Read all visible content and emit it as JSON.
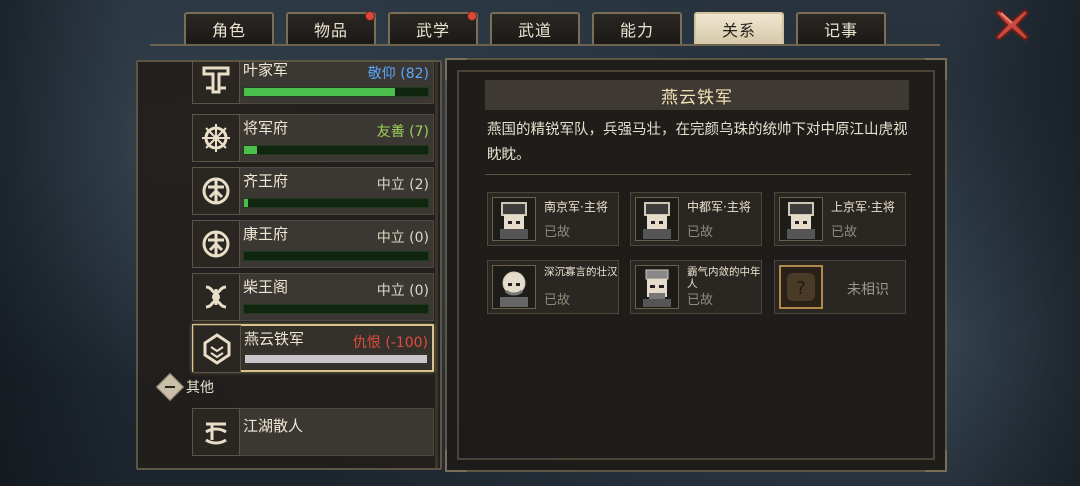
{
  "tabs": [
    {
      "label": "角色",
      "badge": false,
      "active": false
    },
    {
      "label": "物品",
      "badge": true,
      "active": false
    },
    {
      "label": "武学",
      "badge": true,
      "active": false
    },
    {
      "label": "武道",
      "badge": false,
      "active": false
    },
    {
      "label": "能力",
      "badge": false,
      "active": false
    },
    {
      "label": "关系",
      "badge": false,
      "active": true
    },
    {
      "label": "记事",
      "badge": false,
      "active": false
    }
  ],
  "factions": [
    {
      "name": "叶家军",
      "status": "敬仰 (82)",
      "status_color": "#5aa6ff",
      "progress": 0.82,
      "selected": false
    },
    {
      "name": "将军府",
      "status": "友善 (7)",
      "status_color": "#9fd05a",
      "progress": 0.07,
      "selected": false
    },
    {
      "name": "齐王府",
      "status": "中立 (2)",
      "status_color": "#dcd6c6",
      "progress": 0.02,
      "selected": false
    },
    {
      "name": "康王府",
      "status": "中立 (0)",
      "status_color": "#dcd6c6",
      "progress": 0.0,
      "selected": false
    },
    {
      "name": "柴王阁",
      "status": "中立 (0)",
      "status_color": "#dcd6c6",
      "progress": 0.0,
      "selected": false
    },
    {
      "name": "燕云铁军",
      "status": "仇恨 (-100)",
      "status_color": "#e04b3e",
      "progress": 1.0,
      "selected": true
    }
  ],
  "other_section": {
    "label": "其他",
    "items": [
      {
        "name": "江湖散人"
      }
    ]
  },
  "detail": {
    "title": "燕云铁军",
    "description": "燕国的精锐军队，兵强马壮，在完颜乌珠的统帅下对中原江山虎视眈眈。",
    "people": [
      {
        "name": "南京军·主将",
        "status": "已故",
        "known": true
      },
      {
        "name": "中都军·主将",
        "status": "已故",
        "known": true
      },
      {
        "name": "上京军·主将",
        "status": "已故",
        "known": true
      },
      {
        "name": "深沉寡言的壮汉",
        "status": "已故",
        "known": true
      },
      {
        "name": "霸气内敛的中年人",
        "status": "已故",
        "known": true
      },
      {
        "name": "未相识",
        "status": "",
        "known": false
      }
    ]
  },
  "icons": {
    "close": "close-x-icon",
    "unknown": "question-mark-icon"
  }
}
